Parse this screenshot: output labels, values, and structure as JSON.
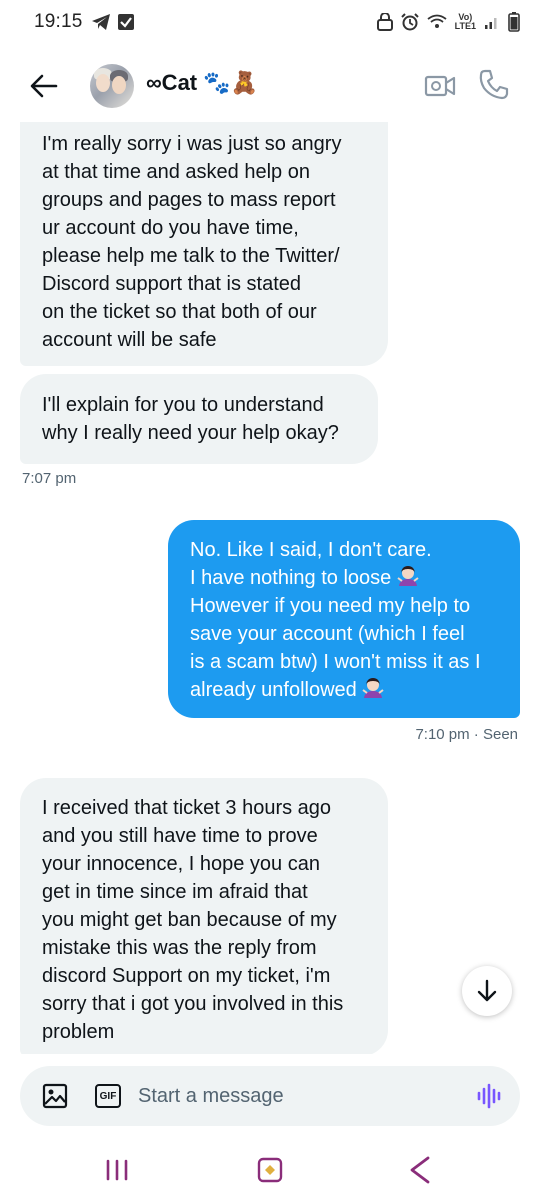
{
  "status_bar": {
    "time": "19:15",
    "network_label": "LTE1",
    "signal_label": "Vo)"
  },
  "header": {
    "contact_name": "∞Cat 🐾🧸",
    "back_icon": "arrow-left-icon",
    "video_icon": "video-icon",
    "call_icon": "phone-icon"
  },
  "messages": [
    {
      "direction": "in",
      "text": "I'm really sorry i was just so angry\nat that time and asked help on\ngroups and pages to mass report\nur account do you have time,\nplease help me talk to the Twitter/\nDiscord support that is stated\non the ticket so that both of our\naccount will be safe"
    },
    {
      "direction": "in",
      "text": "I'll explain for you to understand\nwhy I really need your help okay?",
      "time": "7:07 pm"
    },
    {
      "direction": "out",
      "text_line1": "No. Like I said, I don't care.",
      "text_line2": "I have nothing to loose",
      "text_line3": "However if you need my help to\nsave your account (which I feel\nis a scam btw) I won't miss it as I\nalready unfollowed",
      "time_status": "7:10 pm · Seen"
    },
    {
      "direction": "in",
      "text": "I received that ticket 3 hours ago\nand you still have time to prove\nyour innocence, I hope you can\nget in time since im afraid that\nyou might get ban because of my\nmistake this was the reply from\ndiscord Support on my ticket, i'm\nsorry that i got you involved in this\nproblem"
    }
  ],
  "composer": {
    "placeholder": "Start a message",
    "gif_label": "GIF"
  },
  "colors": {
    "outgoing_bubble": "#1d9bf0",
    "incoming_bubble": "#eff3f4",
    "voice_accent": "#7856ff"
  }
}
